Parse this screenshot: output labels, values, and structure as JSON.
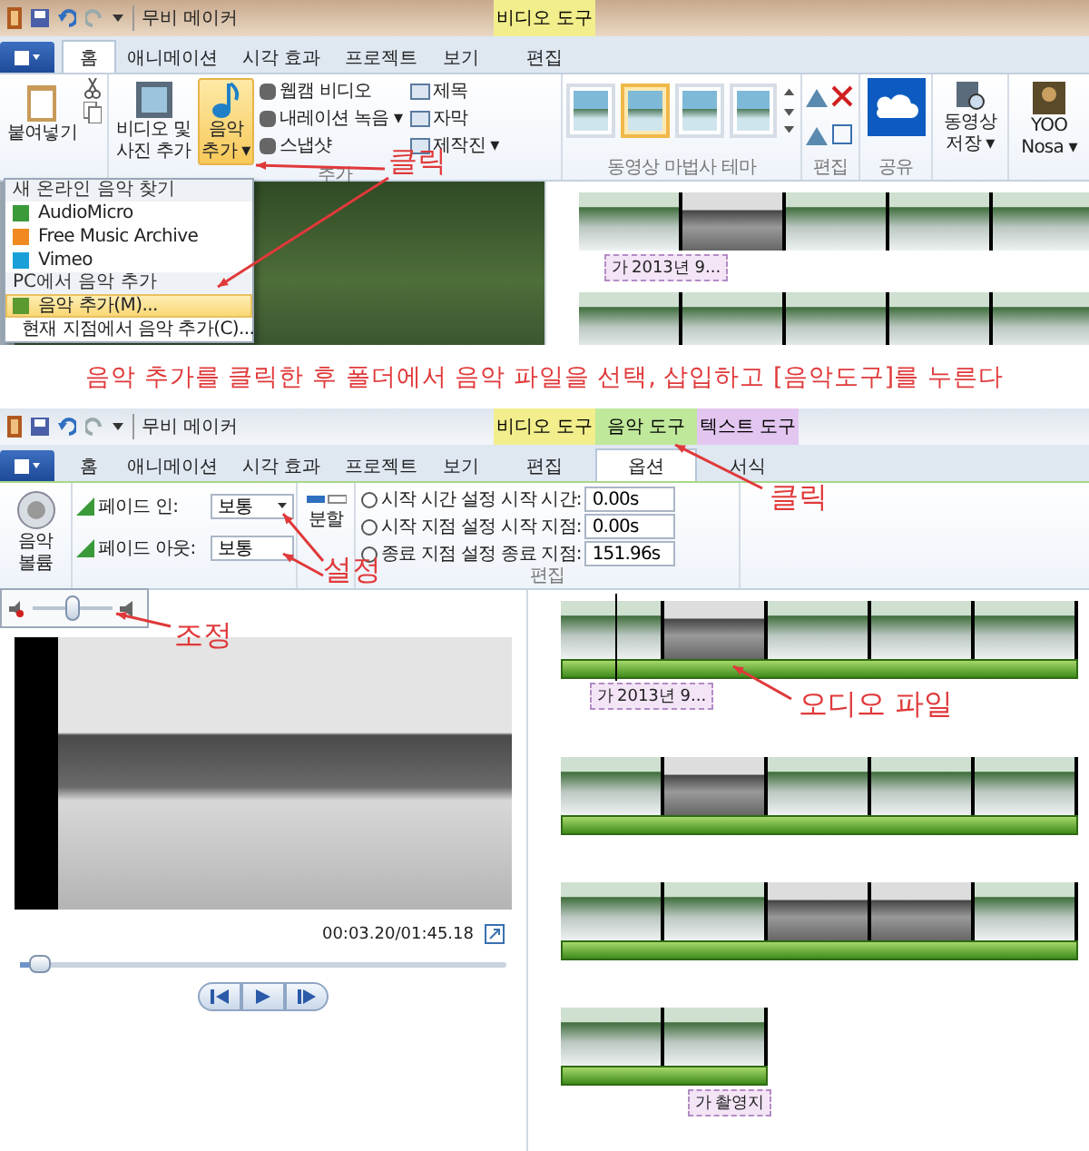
{
  "top": {
    "title": "무비 메이커",
    "context_tabs": [
      {
        "label": "비디오 도구",
        "color": "#f2ee8c"
      }
    ],
    "tabs": [
      {
        "label": "홈",
        "selected": true
      },
      {
        "label": "애니메이션",
        "selected": false
      },
      {
        "label": "시각 효과",
        "selected": false
      },
      {
        "label": "프로젝트",
        "selected": false
      },
      {
        "label": "보기",
        "selected": false
      },
      {
        "label": "편집",
        "selected": false
      }
    ],
    "ribbon": {
      "paste": "붙여넣기",
      "add_video": [
        "비디오 및",
        "사진 추가"
      ],
      "add_music": {
        "lines": [
          "음악",
          "추가 ▾"
        ],
        "selected": true
      },
      "small_buttons": [
        "웹캠 비디오",
        "내레이션 녹음 ▾",
        "스냅샷"
      ],
      "caption_buttons": [
        "제목",
        "자막",
        "제작진 ▾"
      ],
      "themes": [
        {
          "selected": false
        },
        {
          "selected": true
        },
        {
          "selected": false
        },
        {
          "selected": false
        }
      ],
      "save_movie": [
        "동영상",
        "저장 ▾"
      ],
      "account": [
        "YOO",
        "Nosa ▾"
      ],
      "group_labels": [
        "추가",
        "동영상 마법사 테마",
        "편집",
        "공유"
      ]
    },
    "music_menu": [
      {
        "kind": "header",
        "label": "새 온라인 음악 찾기"
      },
      {
        "kind": "item",
        "label": "AudioMicro",
        "selected": false
      },
      {
        "kind": "item",
        "label": "Free Music Archive",
        "selected": false
      },
      {
        "kind": "item",
        "label": "Vimeo",
        "selected": false
      },
      {
        "kind": "header",
        "label": "PC에서 음악 추가"
      },
      {
        "kind": "item",
        "label": "음악 추가(M)...",
        "selected": true
      },
      {
        "kind": "item",
        "label": "현재 지점에서 음악 추가(C)...",
        "selected": false
      }
    ],
    "caption_tag": {
      "glyph": "가",
      "text": "2013년 9..."
    },
    "annotation": "클릭"
  },
  "caption": "음악 추가를 클릭한 후 폴더에서 음악 파일을 선택, 삽입하고 [음악도구]를 누른다",
  "bottom": {
    "title": "무비 메이커",
    "context_tabs": [
      {
        "label": "비디오 도구",
        "color": "#f2ee8c"
      },
      {
        "label": "음악 도구",
        "color": "#bfe89a"
      },
      {
        "label": "텍스트 도구",
        "color": "#e2c6f0"
      }
    ],
    "tabs": [
      {
        "label": "홈",
        "selected": false
      },
      {
        "label": "애니메이션",
        "selected": false
      },
      {
        "label": "시각 효과",
        "selected": false
      },
      {
        "label": "프로젝트",
        "selected": false
      },
      {
        "label": "보기",
        "selected": false
      },
      {
        "label": "편집",
        "selected": false
      },
      {
        "label": "옵션",
        "selected": true
      },
      {
        "label": "서식",
        "selected": false
      }
    ],
    "ribbon": {
      "volume": [
        "음악",
        "볼륨"
      ],
      "fade": [
        {
          "label": "페이드 인:",
          "value": "보통"
        },
        {
          "label": "페이드 아웃:",
          "value": "보통"
        }
      ],
      "split": "분할",
      "set_buttons": [
        "시작 시간 설정",
        "시작 지점 설정",
        "종료 지점 설정"
      ],
      "fields": [
        {
          "label": "시작 시간:",
          "value": "0.00s"
        },
        {
          "label": "시작 지점:",
          "value": "0.00s"
        },
        {
          "label": "종료 지점:",
          "value": "151.96s"
        }
      ],
      "group_label": "편집"
    },
    "volume_popup": {
      "level": 0.5
    },
    "player": {
      "time": "00:03.20/01:45.18",
      "level": 0.04
    },
    "storyboard": [
      {
        "clips": [
          {
            "kind": "color"
          },
          {
            "kind": "gray"
          },
          {
            "kind": "color"
          },
          {
            "kind": "color"
          },
          {
            "kind": "color"
          }
        ],
        "tag": {
          "glyph": "가",
          "text": "2013년 9..."
        },
        "playhead": true
      },
      {
        "clips": [
          {
            "kind": "color"
          },
          {
            "kind": "gray"
          },
          {
            "kind": "color"
          },
          {
            "kind": "color"
          },
          {
            "kind": "color"
          }
        ]
      },
      {
        "clips": [
          {
            "kind": "color"
          },
          {
            "kind": "color"
          },
          {
            "kind": "gray"
          },
          {
            "kind": "gray"
          },
          {
            "kind": "color"
          }
        ]
      },
      {
        "clips": [
          {
            "kind": "color"
          },
          {
            "kind": "color"
          }
        ],
        "tag": {
          "glyph": "가",
          "text": "촬영지"
        }
      }
    ],
    "annotations": {
      "click": "클릭",
      "set": "설정",
      "adjust": "조정",
      "audio": "오디오 파일"
    }
  }
}
